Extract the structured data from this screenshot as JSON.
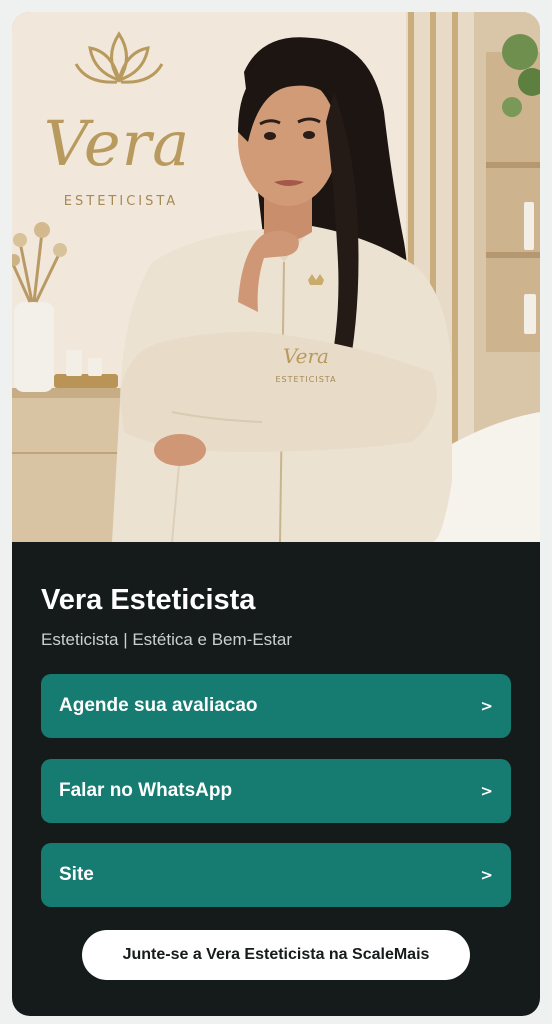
{
  "profile": {
    "name": "Vera Esteticista",
    "subtitle": "Esteticista | Estética e Bem-Estar"
  },
  "hero": {
    "logo_text": "Vera",
    "logo_subtext": "ESTETICISTA"
  },
  "links": [
    {
      "label": "Agende sua avaliacao",
      "chevron": ">"
    },
    {
      "label": "Falar no WhatsApp",
      "chevron": ">"
    },
    {
      "label": "Site",
      "chevron": ">"
    }
  ],
  "join": {
    "label": "Junte-se a Vera Esteticista na ScaleMais"
  },
  "colors": {
    "background": "#eef1ef",
    "card": "#141b1a",
    "button": "#167b70",
    "join_button": "#ffffff",
    "gold": "#b89a5e"
  }
}
